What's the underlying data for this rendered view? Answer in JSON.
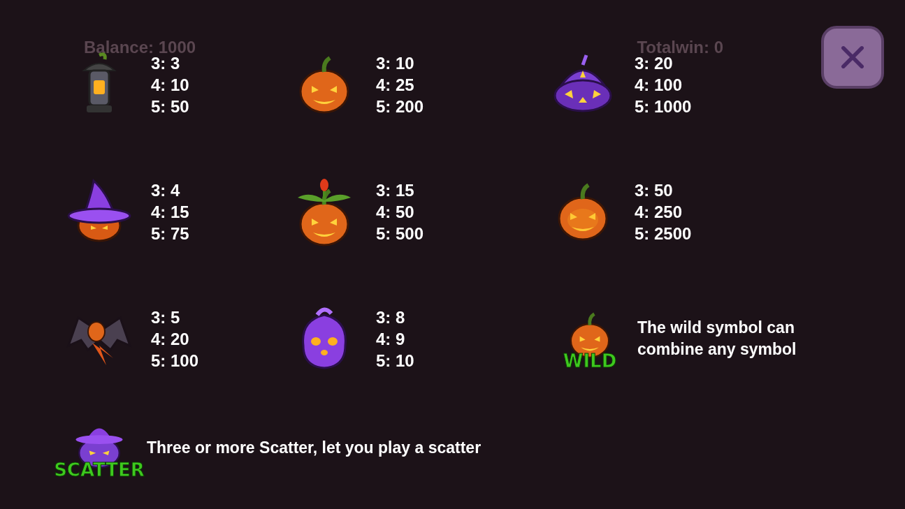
{
  "background": {
    "balance": "Balance: 1000",
    "total_win": "Totalwin: 0"
  },
  "paytable": [
    {
      "kind": "lantern",
      "pays": [
        "3: 3",
        "4: 10",
        "5: 50"
      ]
    },
    {
      "kind": "pumpkin",
      "pays": [
        "3: 10",
        "4: 25",
        "5: 200"
      ]
    },
    {
      "kind": "cauldron",
      "pays": [
        "3: 20",
        "4: 100",
        "5: 1000"
      ]
    },
    {
      "kind": "hat",
      "pays": [
        "3: 4",
        "4: 15",
        "5: 75"
      ]
    },
    {
      "kind": "sprout",
      "pays": [
        "3: 15",
        "4: 50",
        "5: 500"
      ]
    },
    {
      "kind": "jack",
      "pays": [
        "3: 50",
        "4: 250",
        "5: 2500"
      ]
    },
    {
      "kind": "bat",
      "pays": [
        "3: 5",
        "4: 20",
        "5: 100"
      ]
    },
    {
      "kind": "ghost",
      "pays": [
        "3: 8",
        "4: 9",
        "5: 10"
      ]
    },
    {
      "kind": "wild",
      "badge": "WILD",
      "description": "The wild symbol can combine any symbol"
    }
  ],
  "scatter": {
    "kind": "scatter",
    "badge": "SCATTER",
    "description": "Three or more Scatter, let you play a scatter"
  }
}
